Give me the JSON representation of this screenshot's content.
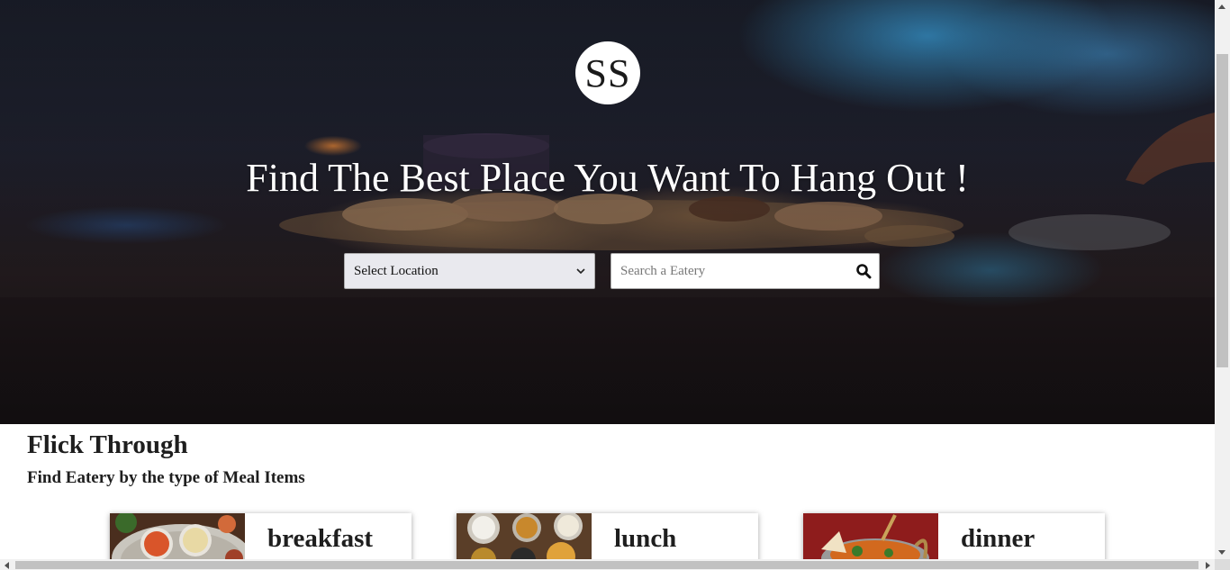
{
  "hero": {
    "logo_text": "SS",
    "headline": "Find The Best Place You Want To Hang Out !",
    "location_select": {
      "selected": "Select Location",
      "icon": "chevron-down-icon"
    },
    "search": {
      "placeholder": "Search a Eatery",
      "icon": "search-icon"
    }
  },
  "section": {
    "title": "Flick Through",
    "subtitle": "Find Eatery by the type of Meal Items"
  },
  "meal_cards": [
    {
      "label": "breakfast"
    },
    {
      "label": "lunch"
    },
    {
      "label": "dinner"
    }
  ]
}
